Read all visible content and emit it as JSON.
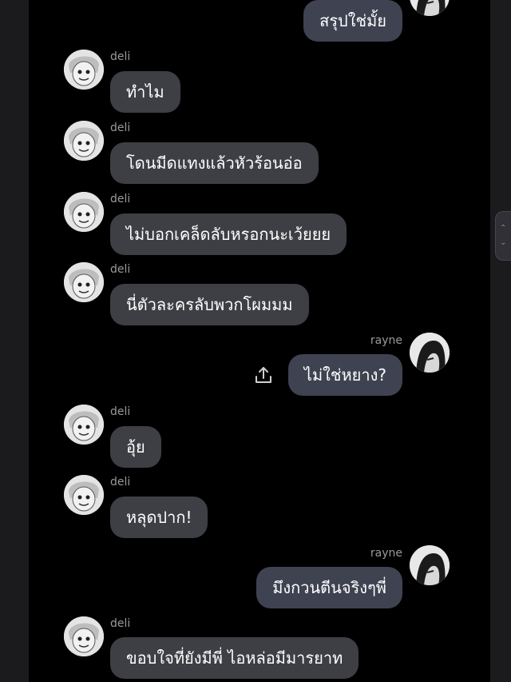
{
  "messages": [
    {
      "sender": "",
      "text": "สรุปใช่มั้ย",
      "mine": true
    },
    {
      "sender": "deli",
      "text": "ทำไม",
      "mine": false
    },
    {
      "sender": "deli",
      "text": "โดนมีดแทงแล้วหัวร้อนอ่อ",
      "mine": false
    },
    {
      "sender": "deli",
      "text": "ไม่บอกเคล็ดลับหรอกนะเว้ยยย",
      "mine": false
    },
    {
      "sender": "deli",
      "text": "นี่ตัวละครลับพวกโผมมม",
      "mine": false
    },
    {
      "sender": "rayne",
      "text": "ไม่ใช่หยาง?",
      "mine": true
    },
    {
      "sender": "deli",
      "text": "อุ้ย",
      "mine": false
    },
    {
      "sender": "deli",
      "text": "หลุดปาก!",
      "mine": false
    },
    {
      "sender": "rayne",
      "text": "มึงกวนตีนจริงๆพี่",
      "mine": true
    },
    {
      "sender": "deli",
      "text": "ขอบใจที่ยังมีพี่ ไอหล่อมีมารยาท",
      "mine": false
    }
  ],
  "icons": {
    "share": "share-upload-icon",
    "scroll_up": "chevron-up-icon",
    "scroll_down": "chevron-down-icon"
  },
  "colors": {
    "background": "#000000",
    "bubble_other": "#3e3f45",
    "bubble_mine": "#3f4250",
    "sender_name": "#9a9a9a",
    "text": "#ffffff"
  }
}
